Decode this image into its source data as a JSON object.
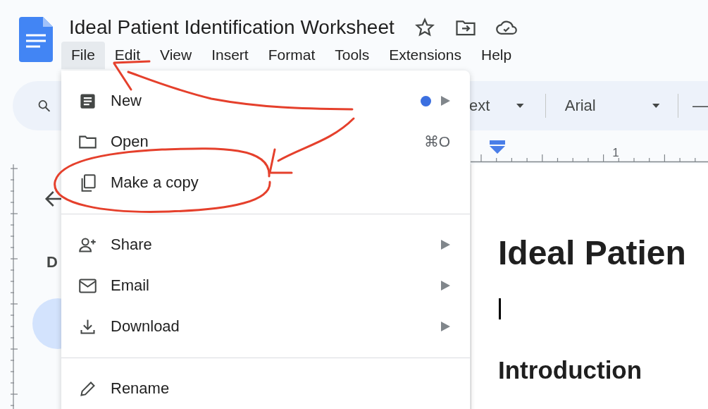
{
  "document": {
    "title": "Ideal Patient Identification Worksheet"
  },
  "menu_bar": [
    {
      "label": "File",
      "selected": true
    },
    {
      "label": "Edit",
      "selected": false
    },
    {
      "label": "View",
      "selected": false
    },
    {
      "label": "Insert",
      "selected": false
    },
    {
      "label": "Format",
      "selected": false
    },
    {
      "label": "Tools",
      "selected": false
    },
    {
      "label": "Extensions",
      "selected": false
    },
    {
      "label": "Help",
      "selected": false
    }
  ],
  "toolbar": {
    "style_dropdown": "ext",
    "font_dropdown": "Arial",
    "minus": "—"
  },
  "ruler": {
    "label": "1"
  },
  "sidebar": {
    "heading": "D"
  },
  "file_menu": [
    [
      {
        "label": "New",
        "submenu": true,
        "dot": true
      },
      {
        "label": "Open",
        "shortcut": "⌘O",
        "submenu": false,
        "dot": false
      },
      {
        "label": "Make a copy",
        "submenu": false,
        "dot": false
      }
    ],
    [
      {
        "label": "Share",
        "submenu": true,
        "dot": false
      },
      {
        "label": "Email",
        "submenu": true,
        "dot": false
      },
      {
        "label": "Download",
        "submenu": true,
        "dot": false
      }
    ],
    [
      {
        "label": "Rename",
        "submenu": false,
        "dot": false
      }
    ]
  ],
  "page": {
    "heading": "Ideal Patien",
    "subheading": "Introduction"
  }
}
